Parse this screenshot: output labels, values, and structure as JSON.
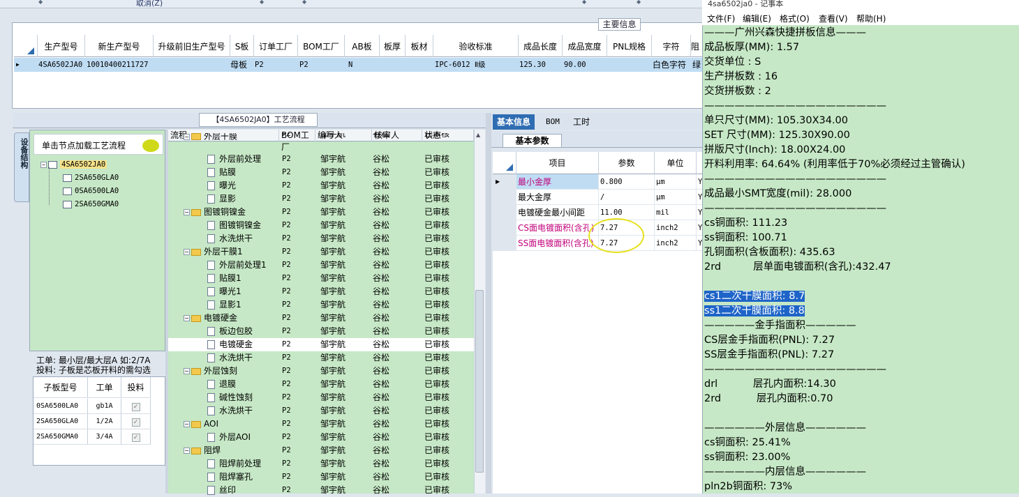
{
  "toolbar": {
    "cancel": "取消(Z)"
  },
  "main": {
    "section_label": "主要信息",
    "headers": [
      "生产型号",
      "新生产型号",
      "升级前旧生产型号",
      "S板",
      "订单工厂",
      "BOM工厂",
      "AB板",
      "板厚",
      "板材",
      "验收标准",
      "成品长度",
      "成品宽度",
      "PNL规格",
      "字符",
      "阻"
    ],
    "row": [
      "4SA6502JA0",
      "10010400211727",
      "",
      "母板",
      "P2",
      "P2",
      "N",
      "",
      "",
      "IPC-6012 Ⅱ级",
      "125.30",
      "90.00",
      "",
      "白色字符",
      "绿"
    ]
  },
  "process": {
    "title": "【4SA6502JA0】工艺流程",
    "tab_vertical": "设备结构",
    "click_hint": "单击节点加载工艺流程",
    "tree": [
      "4SA6502JA0",
      "2SA650GLA0",
      "0SA6500LA0",
      "2SA650GMA0"
    ],
    "note1": "工单: 最小层/最大层A 如:2/7A",
    "note2": "投料: 子板是芯板开料的需勾选",
    "sub_headers": [
      "子板型号",
      "工单",
      "投料"
    ],
    "sub_rows": [
      [
        "0SA6500LA0",
        "gb1A"
      ],
      [
        "2SA650GLA0",
        "1/2A"
      ],
      [
        "2SA650GMA0",
        "3/4A"
      ]
    ],
    "flow_headers": [
      "流程",
      "BOM工厂",
      "编写人",
      "核审人",
      "状态"
    ],
    "flow_rows": [
      {
        "name": "外层干膜",
        "type": "folder",
        "bom": "P2",
        "writer": "邹宇航",
        "checker": "谷松",
        "status": "已审核"
      },
      {
        "name": "外层前处理",
        "type": "doc",
        "bom": "P2",
        "writer": "邹宇航",
        "checker": "谷松",
        "status": "已审核"
      },
      {
        "name": "贴膜",
        "type": "doc",
        "bom": "P2",
        "writer": "邹宇航",
        "checker": "谷松",
        "status": "已审核"
      },
      {
        "name": "曝光",
        "type": "doc",
        "bom": "P2",
        "writer": "邹宇航",
        "checker": "谷松",
        "status": "已审核"
      },
      {
        "name": "显影",
        "type": "doc",
        "bom": "P2",
        "writer": "邹宇航",
        "checker": "谷松",
        "status": "已审核"
      },
      {
        "name": "图镀铜镍金",
        "type": "folder",
        "bom": "P2",
        "writer": "邹宇航",
        "checker": "谷松",
        "status": "已审核"
      },
      {
        "name": "图镀铜镍金",
        "type": "doc",
        "bom": "P2",
        "writer": "邹宇航",
        "checker": "谷松",
        "status": "已审核"
      },
      {
        "name": "水洗烘干",
        "type": "doc",
        "bom": "P2",
        "writer": "邹宇航",
        "checker": "谷松",
        "status": "已审核"
      },
      {
        "name": "外层干膜1",
        "type": "folder",
        "bom": "P2",
        "writer": "邹宇航",
        "checker": "谷松",
        "status": "已审核"
      },
      {
        "name": "外层前处理1",
        "type": "doc",
        "bom": "P2",
        "writer": "邹宇航",
        "checker": "谷松",
        "status": "已审核"
      },
      {
        "name": "贴膜1",
        "type": "doc",
        "bom": "P2",
        "writer": "邹宇航",
        "checker": "谷松",
        "status": "已审核"
      },
      {
        "name": "曝光1",
        "type": "doc",
        "bom": "P2",
        "writer": "邹宇航",
        "checker": "谷松",
        "status": "已审核"
      },
      {
        "name": "显影1",
        "type": "doc",
        "bom": "P2",
        "writer": "邹宇航",
        "checker": "谷松",
        "status": "已审核"
      },
      {
        "name": "电镀硬金",
        "type": "folder",
        "bom": "P2",
        "writer": "邹宇航",
        "checker": "谷松",
        "status": "已审核"
      },
      {
        "name": "板边包胶",
        "type": "doc",
        "bom": "P2",
        "writer": "邹宇航",
        "checker": "谷松",
        "status": "已审核"
      },
      {
        "name": "电镀硬金",
        "type": "doc",
        "bom": "P2",
        "writer": "邹宇航",
        "checker": "谷松",
        "status": "已审核"
      },
      {
        "name": "水洗烘干",
        "type": "doc",
        "bom": "P2",
        "writer": "邹宇航",
        "checker": "谷松",
        "status": "已审核"
      },
      {
        "name": "外层蚀刻",
        "type": "folder",
        "bom": "P2",
        "writer": "邹宇航",
        "checker": "谷松",
        "status": "已审核"
      },
      {
        "name": "退膜",
        "type": "doc",
        "bom": "P2",
        "writer": "邹宇航",
        "checker": "谷松",
        "status": "已审核"
      },
      {
        "name": "碱性蚀刻",
        "type": "doc",
        "bom": "P2",
        "writer": "邹宇航",
        "checker": "谷松",
        "status": "已审核"
      },
      {
        "name": "水洗烘干",
        "type": "doc",
        "bom": "P2",
        "writer": "邹宇航",
        "checker": "谷松",
        "status": "已审核"
      },
      {
        "name": "AOI",
        "type": "folder",
        "bom": "P2",
        "writer": "邹宇航",
        "checker": "谷松",
        "status": "已审核"
      },
      {
        "name": "外层AOI",
        "type": "doc",
        "bom": "P2",
        "writer": "邹宇航",
        "checker": "谷松",
        "status": "已审核"
      },
      {
        "name": "阻焊",
        "type": "folder",
        "bom": "P2",
        "writer": "邹宇航",
        "checker": "谷松",
        "status": "已审核"
      },
      {
        "name": "阻焊前处理",
        "type": "doc",
        "bom": "P2",
        "writer": "邹宇航",
        "checker": "谷松",
        "status": "已审核"
      },
      {
        "name": "阻焊塞孔",
        "type": "doc",
        "bom": "P2",
        "writer": "邹宇航",
        "checker": "谷松",
        "status": "已审核"
      },
      {
        "name": "丝印",
        "type": "doc",
        "bom": "P2",
        "writer": "邹宇航",
        "checker": "谷松",
        "status": "已审核"
      }
    ]
  },
  "params": {
    "tabs": [
      "基本信息",
      "BOM",
      "工时"
    ],
    "sub_tab": "基本参数",
    "headers": [
      "项目",
      "参数",
      "单位"
    ],
    "rows": [
      {
        "item": "最小金厚",
        "value": "0.800",
        "unit": "μm",
        "extra": "Y",
        "color": "#c0007a"
      },
      {
        "item": "最大金厚",
        "value": "/",
        "unit": "μm",
        "extra": "Y",
        "color": "#000000"
      },
      {
        "item": "电镀硬金最小间距",
        "value": "11.00",
        "unit": "mil",
        "extra": "Y",
        "color": "#000000"
      },
      {
        "item": "CS面电镀面积(含孔)",
        "value": "7.27",
        "unit": "inch2",
        "extra": "Y",
        "color": "#c0007a"
      },
      {
        "item": "SS面电镀面积(含孔)",
        "value": "7.27",
        "unit": "inch2",
        "extra": "Y",
        "color": "#c0007a"
      }
    ]
  },
  "notepad": {
    "title": "4sa6502ja0 - 记事本",
    "menu": [
      "文件(F)",
      "编辑(E)",
      "格式(O)",
      "查看(V)",
      "帮助(H)"
    ],
    "lines": [
      "———广州兴森快捷拼板信息———",
      "成品板厚(MM): 1.57",
      "交货单位 : S",
      "生产拼板数 : 16",
      "交货拼板数 : 2",
      "——————————————————",
      "单只尺寸(MM): 105.30X34.00",
      "SET 尺寸(MM): 125.30X90.00",
      "拼版尺寸(Inch): 18.00X24.00",
      "开料利用率: 64.64% (利用率低于70%必须经过主管确认)",
      "——————————————————",
      "成品最小SMT宽度(mil): 28.000",
      "——————————————————",
      "cs铜面积: 111.23",
      "ss铜面积: 100.71",
      "孔铜面积(含板面积): 435.63",
      "2rd          层单面电镀面积(含孔):432.47",
      "",
      "cs1二次干膜面积: 8.7",
      "ss1二次干膜面积: 8.8",
      "—————金手指面积—————",
      "CS层金手指面积(PNL): 7.27",
      "SS层金手指面积(PNL): 7.27",
      "——————————————————",
      "drl           层孔内面积:14.30",
      "2rd           层孔内面积:0.70",
      "",
      "——————外层信息——————",
      "cs铜面积: 25.41%",
      "ss铜面积: 23.00%",
      "——————内层信息——————",
      "pln2b铜面积: 73%"
    ]
  }
}
